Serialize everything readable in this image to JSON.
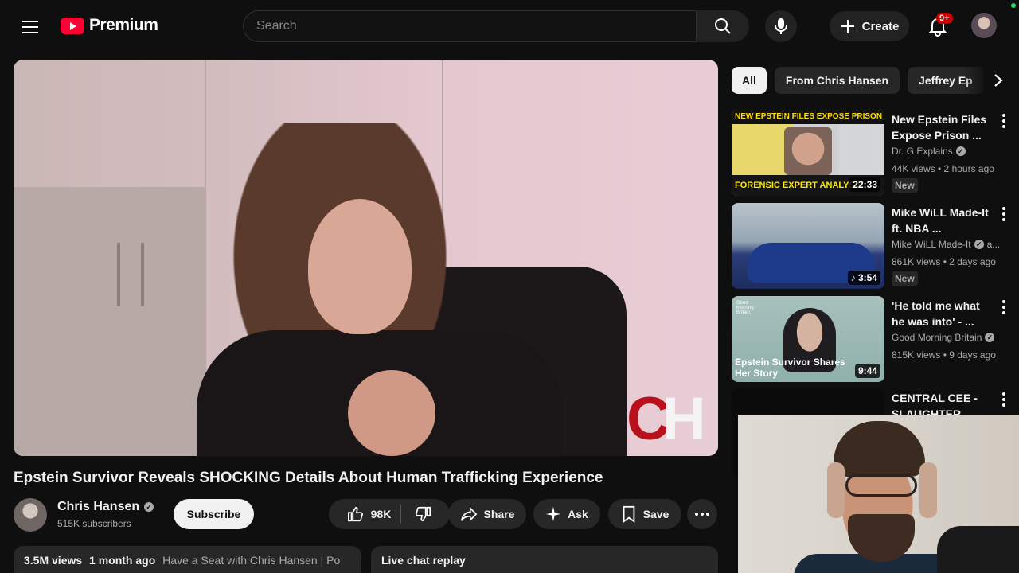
{
  "header": {
    "logo_text": "Premium",
    "search_placeholder": "Search",
    "create_label": "Create",
    "notification_count": "9+"
  },
  "video": {
    "title": "Epstein Survivor Reveals SHOCKING Details About Human Trafficking Experience",
    "channel": "Chris Hansen",
    "subscribers": "515K subscribers",
    "subscribe_label": "Subscribe",
    "likes": "98K",
    "share_label": "Share",
    "ask_label": "Ask",
    "save_label": "Save",
    "views": "3.5M views",
    "age": "1 month ago",
    "tags": "Have a Seat with Chris Hansen | Po",
    "live_chat_label": "Live chat replay",
    "watermark_c": "C",
    "watermark_h": "H"
  },
  "chips": [
    {
      "label": "All",
      "active": true
    },
    {
      "label": "From Chris Hansen",
      "active": false
    },
    {
      "label": "Jeffrey Ep",
      "active": false
    }
  ],
  "recommendations": [
    {
      "title": "New Epstein Files Expose Prison ...",
      "channel": "Dr. G Explains",
      "verified": true,
      "meta": "44K views • 2 hours ago",
      "badge": "New",
      "duration": "22:33",
      "thumb_top": "NEW EPSTEIN FILES EXPOSE PRISON COVER UP",
      "thumb_bottom": "FORENSIC EXPERT ANALYSIS"
    },
    {
      "title": "Mike WiLL Made-It ft. NBA ...",
      "channel": "Mike WiLL Made-It",
      "verified": true,
      "channel_suffix": "a...",
      "meta": "861K views • 2 days ago",
      "badge": "New",
      "duration": "3:54"
    },
    {
      "title": "'He told me what he was into' - ...",
      "channel": "Good Morning Britain",
      "verified": true,
      "meta": "815K views • 9 days ago",
      "badge": "",
      "duration": "9:44",
      "thumb_caption": "Epstein Survivor Shares Her Story",
      "thumb_brand": "Good Morning Britain"
    },
    {
      "title": "CENTRAL CEE - SLAUGHTER ...",
      "channel": "",
      "meta": "",
      "badge": "",
      "duration": ""
    }
  ]
}
